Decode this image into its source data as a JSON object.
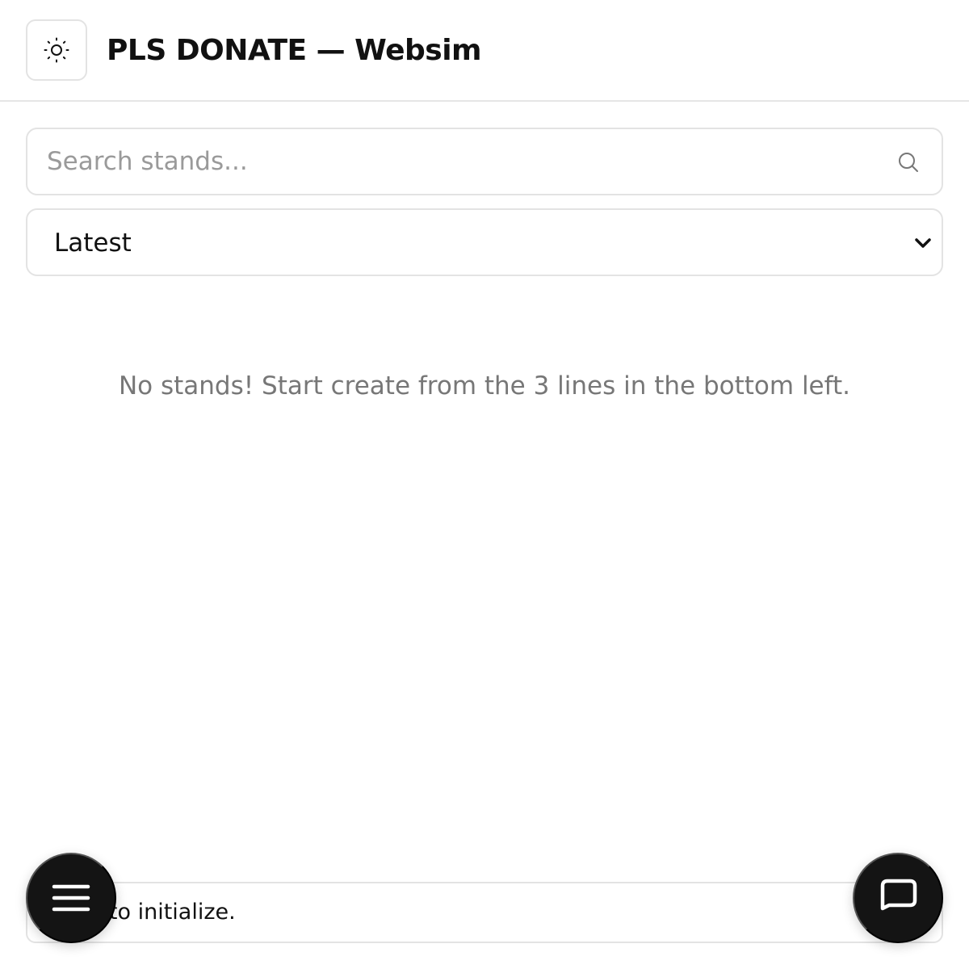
{
  "header": {
    "title": "PLS DONATE — Websim",
    "theme_icon": "sun-icon"
  },
  "search": {
    "placeholder": "Search stands...",
    "value": "",
    "icon": "search-icon"
  },
  "sort": {
    "selected": "Latest",
    "icon": "chevron-down-icon"
  },
  "main": {
    "empty_message": "No stands! Start create from the 3 lines in the bottom left."
  },
  "status": {
    "text": "Click to initialize."
  },
  "fab": {
    "menu_icon": "menu-icon",
    "chat_icon": "chat-icon"
  },
  "colors": {
    "fab_background": "#141414",
    "border": "#e3e3e3",
    "muted_text": "#777777",
    "placeholder_text": "#9a9a9a"
  }
}
